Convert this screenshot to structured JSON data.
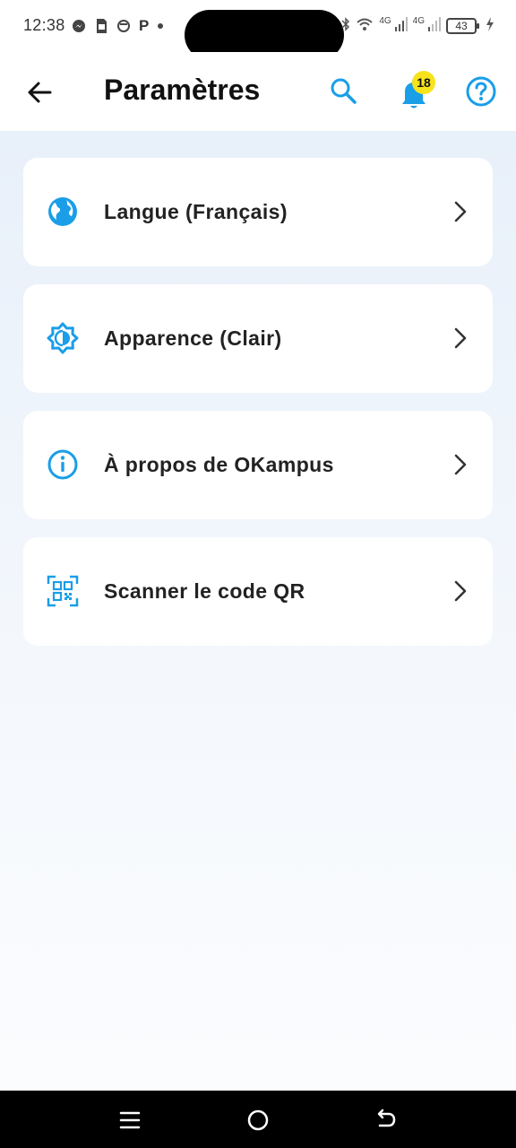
{
  "status_bar": {
    "time": "12:38",
    "left_icons": [
      "messenger-icon",
      "sim-card-icon",
      "circle-status-icon",
      "p-app-icon",
      "dot-icon"
    ],
    "right_icons": [
      "bluetooth-icon",
      "wifi-icon",
      "signal-4g-icon",
      "signal-4g-icon",
      "battery-icon",
      "charging-icon"
    ],
    "network_1": "4G",
    "network_2": "4G",
    "battery_level": "43",
    "p_app_letter": "P"
  },
  "app_bar": {
    "title": "Paramètres",
    "notification_count": "18",
    "icons": [
      "back-arrow-icon",
      "search-icon",
      "bell-icon",
      "help-icon"
    ]
  },
  "settings": [
    {
      "label": "Langue (Français)",
      "icon": "globe-icon"
    },
    {
      "label": "Apparence (Clair)",
      "icon": "brightness-icon"
    },
    {
      "label": "À propos de OKampus",
      "icon": "info-icon"
    },
    {
      "label": "Scanner le code QR",
      "icon": "qr-code-icon"
    }
  ],
  "colors": {
    "accent": "#1a9ee8",
    "badge": "#f6e31c",
    "background_top": "#e8f0fa",
    "card": "#ffffff",
    "text": "#222222",
    "nav_bar": "#000000"
  },
  "nav_bar": {
    "icons": [
      "menu-icon",
      "home-icon",
      "back-icon"
    ]
  }
}
